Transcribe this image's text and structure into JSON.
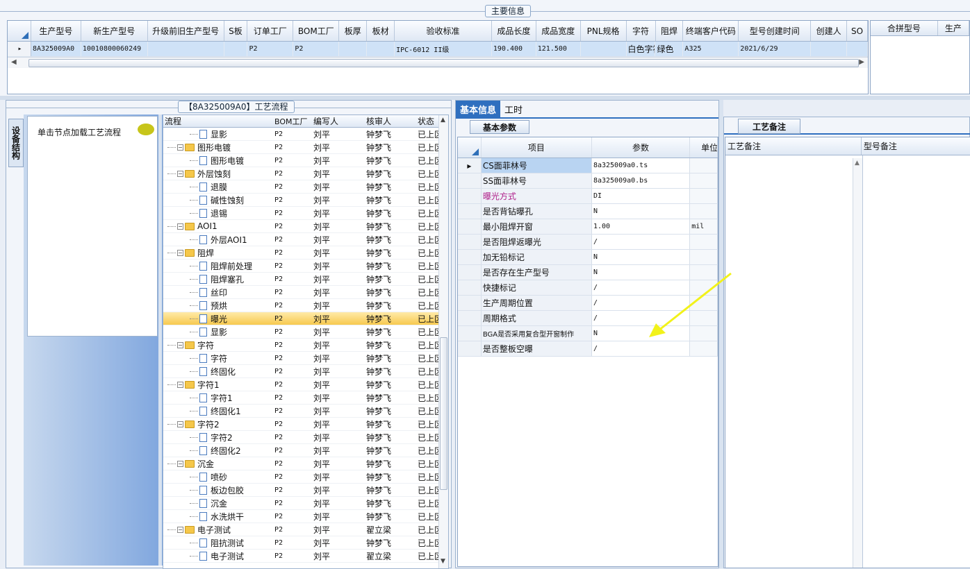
{
  "main_info": {
    "title": "主要信息",
    "columns": [
      "生产型号",
      "新生产型号",
      "升级前旧生产型号",
      "S板",
      "订单工厂",
      "BOM工厂",
      "板厚",
      "板材",
      "验收标准",
      "成品长度",
      "成品宽度",
      "PNL规格",
      "字符",
      "阻焊",
      "终端客户代码",
      "型号创建时间",
      "创建人",
      "SO"
    ],
    "row": [
      "8A325009A0",
      "10010800060249",
      "",
      "",
      "P2",
      "P2",
      "",
      "",
      "IPC-6012 II级",
      "190.400",
      "121.500",
      "",
      "白色字符",
      "绿色",
      "A325",
      "2021/6/29",
      "",
      ""
    ],
    "side_columns": [
      "合拼型号",
      "生产"
    ]
  },
  "flow_panel": {
    "title": "【8A325009A0】工艺流程",
    "vtab_label": "设备结构",
    "hint": "单击节点加载工艺流程",
    "columns": [
      "流程",
      "BOM工厂",
      "编写人",
      "核审人",
      "状态"
    ],
    "rows": [
      {
        "label": "显影",
        "type": "doc",
        "f": "P2",
        "w": "刘平",
        "r": "钟梦飞",
        "s": "已上区"
      },
      {
        "label": "图形电镀",
        "type": "folder",
        "f": "P2",
        "w": "刘平",
        "r": "钟梦飞",
        "s": "已上区"
      },
      {
        "label": "图形电镀",
        "type": "doc",
        "f": "P2",
        "w": "刘平",
        "r": "钟梦飞",
        "s": "已上区"
      },
      {
        "label": "外层蚀刻",
        "type": "folder",
        "f": "P2",
        "w": "刘平",
        "r": "钟梦飞",
        "s": "已上区"
      },
      {
        "label": "退膜",
        "type": "doc",
        "f": "P2",
        "w": "刘平",
        "r": "钟梦飞",
        "s": "已上区"
      },
      {
        "label": "碱性蚀刻",
        "type": "doc",
        "f": "P2",
        "w": "刘平",
        "r": "钟梦飞",
        "s": "已上区"
      },
      {
        "label": "退锡",
        "type": "doc",
        "f": "P2",
        "w": "刘平",
        "r": "钟梦飞",
        "s": "已上区"
      },
      {
        "label": "AOI1",
        "type": "folder",
        "f": "P2",
        "w": "刘平",
        "r": "钟梦飞",
        "s": "已上区"
      },
      {
        "label": "外层AOI1",
        "type": "doc",
        "f": "P2",
        "w": "刘平",
        "r": "钟梦飞",
        "s": "已上区"
      },
      {
        "label": "阻焊",
        "type": "folder",
        "f": "P2",
        "w": "刘平",
        "r": "钟梦飞",
        "s": "已上区"
      },
      {
        "label": "阻焊前处理",
        "type": "doc",
        "f": "P2",
        "w": "刘平",
        "r": "钟梦飞",
        "s": "已上区"
      },
      {
        "label": "阻焊塞孔",
        "type": "doc",
        "f": "P2",
        "w": "刘平",
        "r": "钟梦飞",
        "s": "已上区"
      },
      {
        "label": "丝印",
        "type": "doc",
        "f": "P2",
        "w": "刘平",
        "r": "钟梦飞",
        "s": "已上区"
      },
      {
        "label": "预烘",
        "type": "doc",
        "f": "P2",
        "w": "刘平",
        "r": "钟梦飞",
        "s": "已上区"
      },
      {
        "label": "曝光",
        "type": "doc",
        "f": "P2",
        "w": "刘平",
        "r": "钟梦飞",
        "s": "已上区",
        "selected": true
      },
      {
        "label": "显影",
        "type": "doc",
        "f": "P2",
        "w": "刘平",
        "r": "钟梦飞",
        "s": "已上区"
      },
      {
        "label": "字符",
        "type": "folder",
        "f": "P2",
        "w": "刘平",
        "r": "钟梦飞",
        "s": "已上区"
      },
      {
        "label": "字符",
        "type": "doc",
        "f": "P2",
        "w": "刘平",
        "r": "钟梦飞",
        "s": "已上区"
      },
      {
        "label": "终固化",
        "type": "doc",
        "f": "P2",
        "w": "刘平",
        "r": "钟梦飞",
        "s": "已上区"
      },
      {
        "label": "字符1",
        "type": "folder",
        "f": "P2",
        "w": "刘平",
        "r": "钟梦飞",
        "s": "已上区"
      },
      {
        "label": "字符1",
        "type": "doc",
        "f": "P2",
        "w": "刘平",
        "r": "钟梦飞",
        "s": "已上区"
      },
      {
        "label": "终固化1",
        "type": "doc",
        "f": "P2",
        "w": "刘平",
        "r": "钟梦飞",
        "s": "已上区"
      },
      {
        "label": "字符2",
        "type": "folder",
        "f": "P2",
        "w": "刘平",
        "r": "钟梦飞",
        "s": "已上区"
      },
      {
        "label": "字符2",
        "type": "doc",
        "f": "P2",
        "w": "刘平",
        "r": "钟梦飞",
        "s": "已上区"
      },
      {
        "label": "终固化2",
        "type": "doc",
        "f": "P2",
        "w": "刘平",
        "r": "钟梦飞",
        "s": "已上区"
      },
      {
        "label": "沉金",
        "type": "folder",
        "f": "P2",
        "w": "刘平",
        "r": "钟梦飞",
        "s": "已上区"
      },
      {
        "label": "喷砂",
        "type": "doc",
        "f": "P2",
        "w": "刘平",
        "r": "钟梦飞",
        "s": "已上区"
      },
      {
        "label": "板边包胶",
        "type": "doc",
        "f": "P2",
        "w": "刘平",
        "r": "钟梦飞",
        "s": "已上区"
      },
      {
        "label": "沉金",
        "type": "doc",
        "f": "P2",
        "w": "刘平",
        "r": "钟梦飞",
        "s": "已上区"
      },
      {
        "label": "水洗烘干",
        "type": "doc",
        "f": "P2",
        "w": "刘平",
        "r": "钟梦飞",
        "s": "已上区"
      },
      {
        "label": "电子测试",
        "type": "folder",
        "f": "P2",
        "w": "刘平",
        "r": "翟立梁",
        "s": "已上区"
      },
      {
        "label": "阻抗测试",
        "type": "doc",
        "f": "P2",
        "w": "刘平",
        "r": "钟梦飞",
        "s": "已上区"
      },
      {
        "label": "电子测试",
        "type": "doc",
        "f": "P2",
        "w": "刘平",
        "r": "翟立梁",
        "s": "已上区"
      }
    ]
  },
  "info_panel": {
    "tabs": [
      "基本信息",
      "工时"
    ],
    "subtab": "基本参数",
    "columns": [
      "项目",
      "参数",
      "单位"
    ],
    "rows": [
      {
        "item": "CS面菲林号",
        "value": "8a325009a0.ts",
        "unit": ""
      },
      {
        "item": "SS面菲林号",
        "value": "8a325009a0.bs",
        "unit": ""
      },
      {
        "item": "曝光方式",
        "value": "DI",
        "unit": "",
        "highlight": true
      },
      {
        "item": "是否背钻曝孔",
        "value": "N",
        "unit": ""
      },
      {
        "item": "最小阻焊开窗",
        "value": "1.00",
        "unit": "mil"
      },
      {
        "item": "是否阻焊返曝光",
        "value": "/",
        "unit": ""
      },
      {
        "item": "加无铅标记",
        "value": "N",
        "unit": ""
      },
      {
        "item": "是否存在生产型号",
        "value": "N",
        "unit": ""
      },
      {
        "item": "快捷标记",
        "value": "/",
        "unit": ""
      },
      {
        "item": "生产周期位置",
        "value": "/",
        "unit": ""
      },
      {
        "item": "周期格式",
        "value": "/",
        "unit": ""
      },
      {
        "item": "BGA是否采用复合型开窗制作",
        "value": "N",
        "unit": ""
      },
      {
        "item": "是否整板空曝",
        "value": "/",
        "unit": ""
      }
    ]
  },
  "note_panel": {
    "tab": "工艺备注",
    "columns": [
      "工艺备注",
      "型号备注"
    ]
  },
  "colors": {
    "arrow": "#f2f21a",
    "highlight_text": "#b0208a",
    "selected_row": "#f7c94f"
  }
}
